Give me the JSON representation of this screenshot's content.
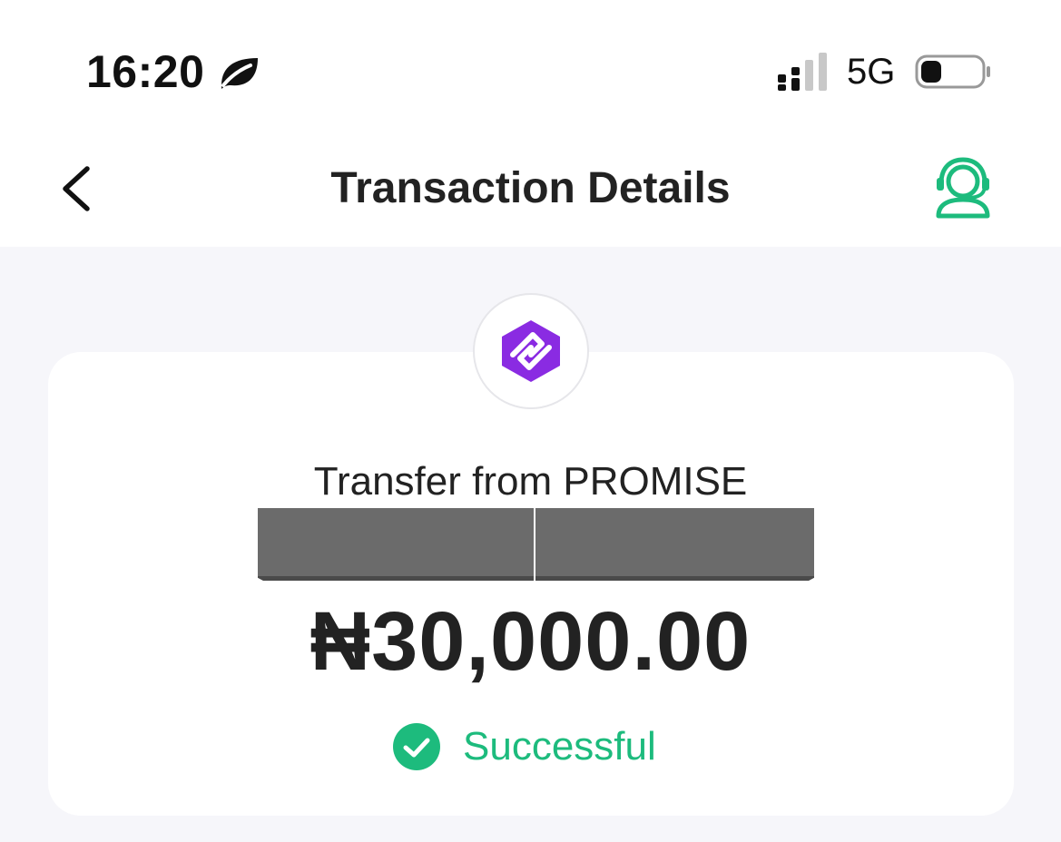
{
  "status_bar": {
    "time": "16:20",
    "network": "5G"
  },
  "header": {
    "title": "Transaction Details"
  },
  "transaction": {
    "label": "Transfer from PROMISE",
    "amount": "₦30,000.00",
    "status": "Successful"
  },
  "icons": {
    "back": "chevron-left-icon",
    "support": "customer-support-icon",
    "status": "check-circle-icon",
    "logo": "app-logo"
  },
  "colors": {
    "accent_green": "#1dbb7d",
    "logo_purple": "#8a2be2",
    "background": "#f6f6fa"
  }
}
